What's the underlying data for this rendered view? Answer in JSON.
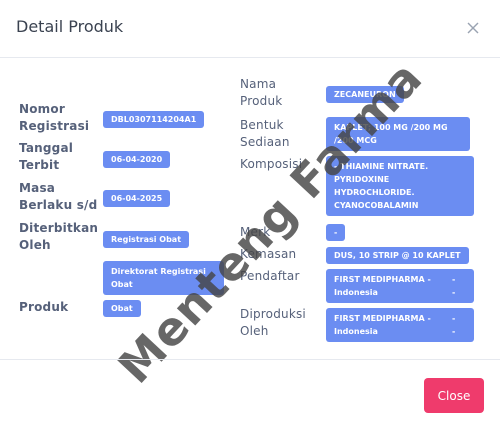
{
  "modal": {
    "title": "Detail Produk",
    "close_button": "Close"
  },
  "left": {
    "nomor_registrasi": {
      "label": "Nomor Registrasi",
      "value": "DBL0307114204A1"
    },
    "tanggal_terbit": {
      "label": "Tanggal Terbit",
      "value": "06-04-2020"
    },
    "masa_berlaku": {
      "label": "Masa Berlaku s/d",
      "value": "06-04-2025"
    },
    "diterbitkan_oleh": {
      "label": "Diterbitkan Oleh",
      "value": "Registrasi Obat",
      "value2": "Direktorat Registrasi Obat"
    },
    "produk": {
      "label": "Produk",
      "value": "Obat"
    }
  },
  "right": {
    "nama_produk": {
      "label": "Nama Produk",
      "value": "ZECANEURON"
    },
    "bentuk_sediaan": {
      "label": "Bentuk Sediaan",
      "value": "KAPLET; 100 MG /200 MG /200 MCG"
    },
    "komposisi": {
      "label": "Komposisi",
      "value": "- THIAMINE NITRATE. PYRIDOXINE HYDROCHLORIDE. CYANOCOBALAMIN"
    },
    "merk": {
      "label": "Merk",
      "value": "-"
    },
    "kemasan": {
      "label": "Kemasan",
      "value": "DUS, 10 STRIP @ 10 KAPLET"
    },
    "pendaftar": {
      "label": "Pendaftar",
      "value": "FIRST MEDIPHARMA - Indonesia",
      "suffix": "- -"
    },
    "diproduksi_oleh": {
      "label": "Diproduksi Oleh",
      "value": "FIRST MEDIPHARMA - Indonesia",
      "suffix": "- -"
    }
  },
  "watermark": "Menteng Farma"
}
